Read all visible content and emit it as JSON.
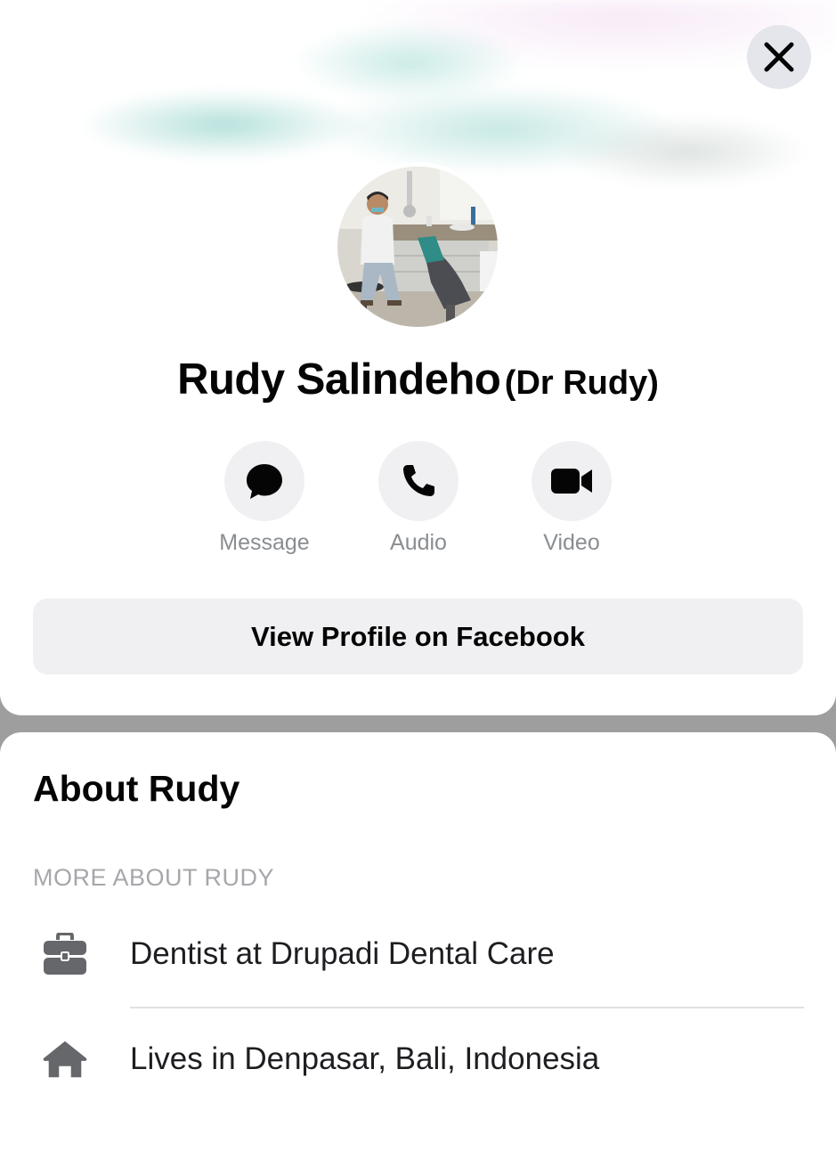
{
  "profile": {
    "name": "Rudy Salindeho",
    "alt_name": "(Dr Rudy)",
    "avatar_icon": "profile-photo"
  },
  "actions": [
    {
      "label": "Message",
      "icon": "message-bubble-icon"
    },
    {
      "label": "Audio",
      "icon": "phone-icon"
    },
    {
      "label": "Video",
      "icon": "video-camera-icon"
    }
  ],
  "view_profile_label": "View Profile on Facebook",
  "about": {
    "title": "About Rudy",
    "section_header": "MORE ABOUT RUDY",
    "items": [
      {
        "icon": "briefcase-icon",
        "text": "Dentist at Drupadi Dental Care"
      },
      {
        "icon": "home-icon",
        "text": "Lives in Denpasar, Bali, Indonesia"
      }
    ]
  },
  "colors": {
    "backdrop": "#9e9e9e",
    "button_bg": "#f0f0f2",
    "secondary_text": "#8a8d91",
    "icon_gray": "#65676b"
  }
}
